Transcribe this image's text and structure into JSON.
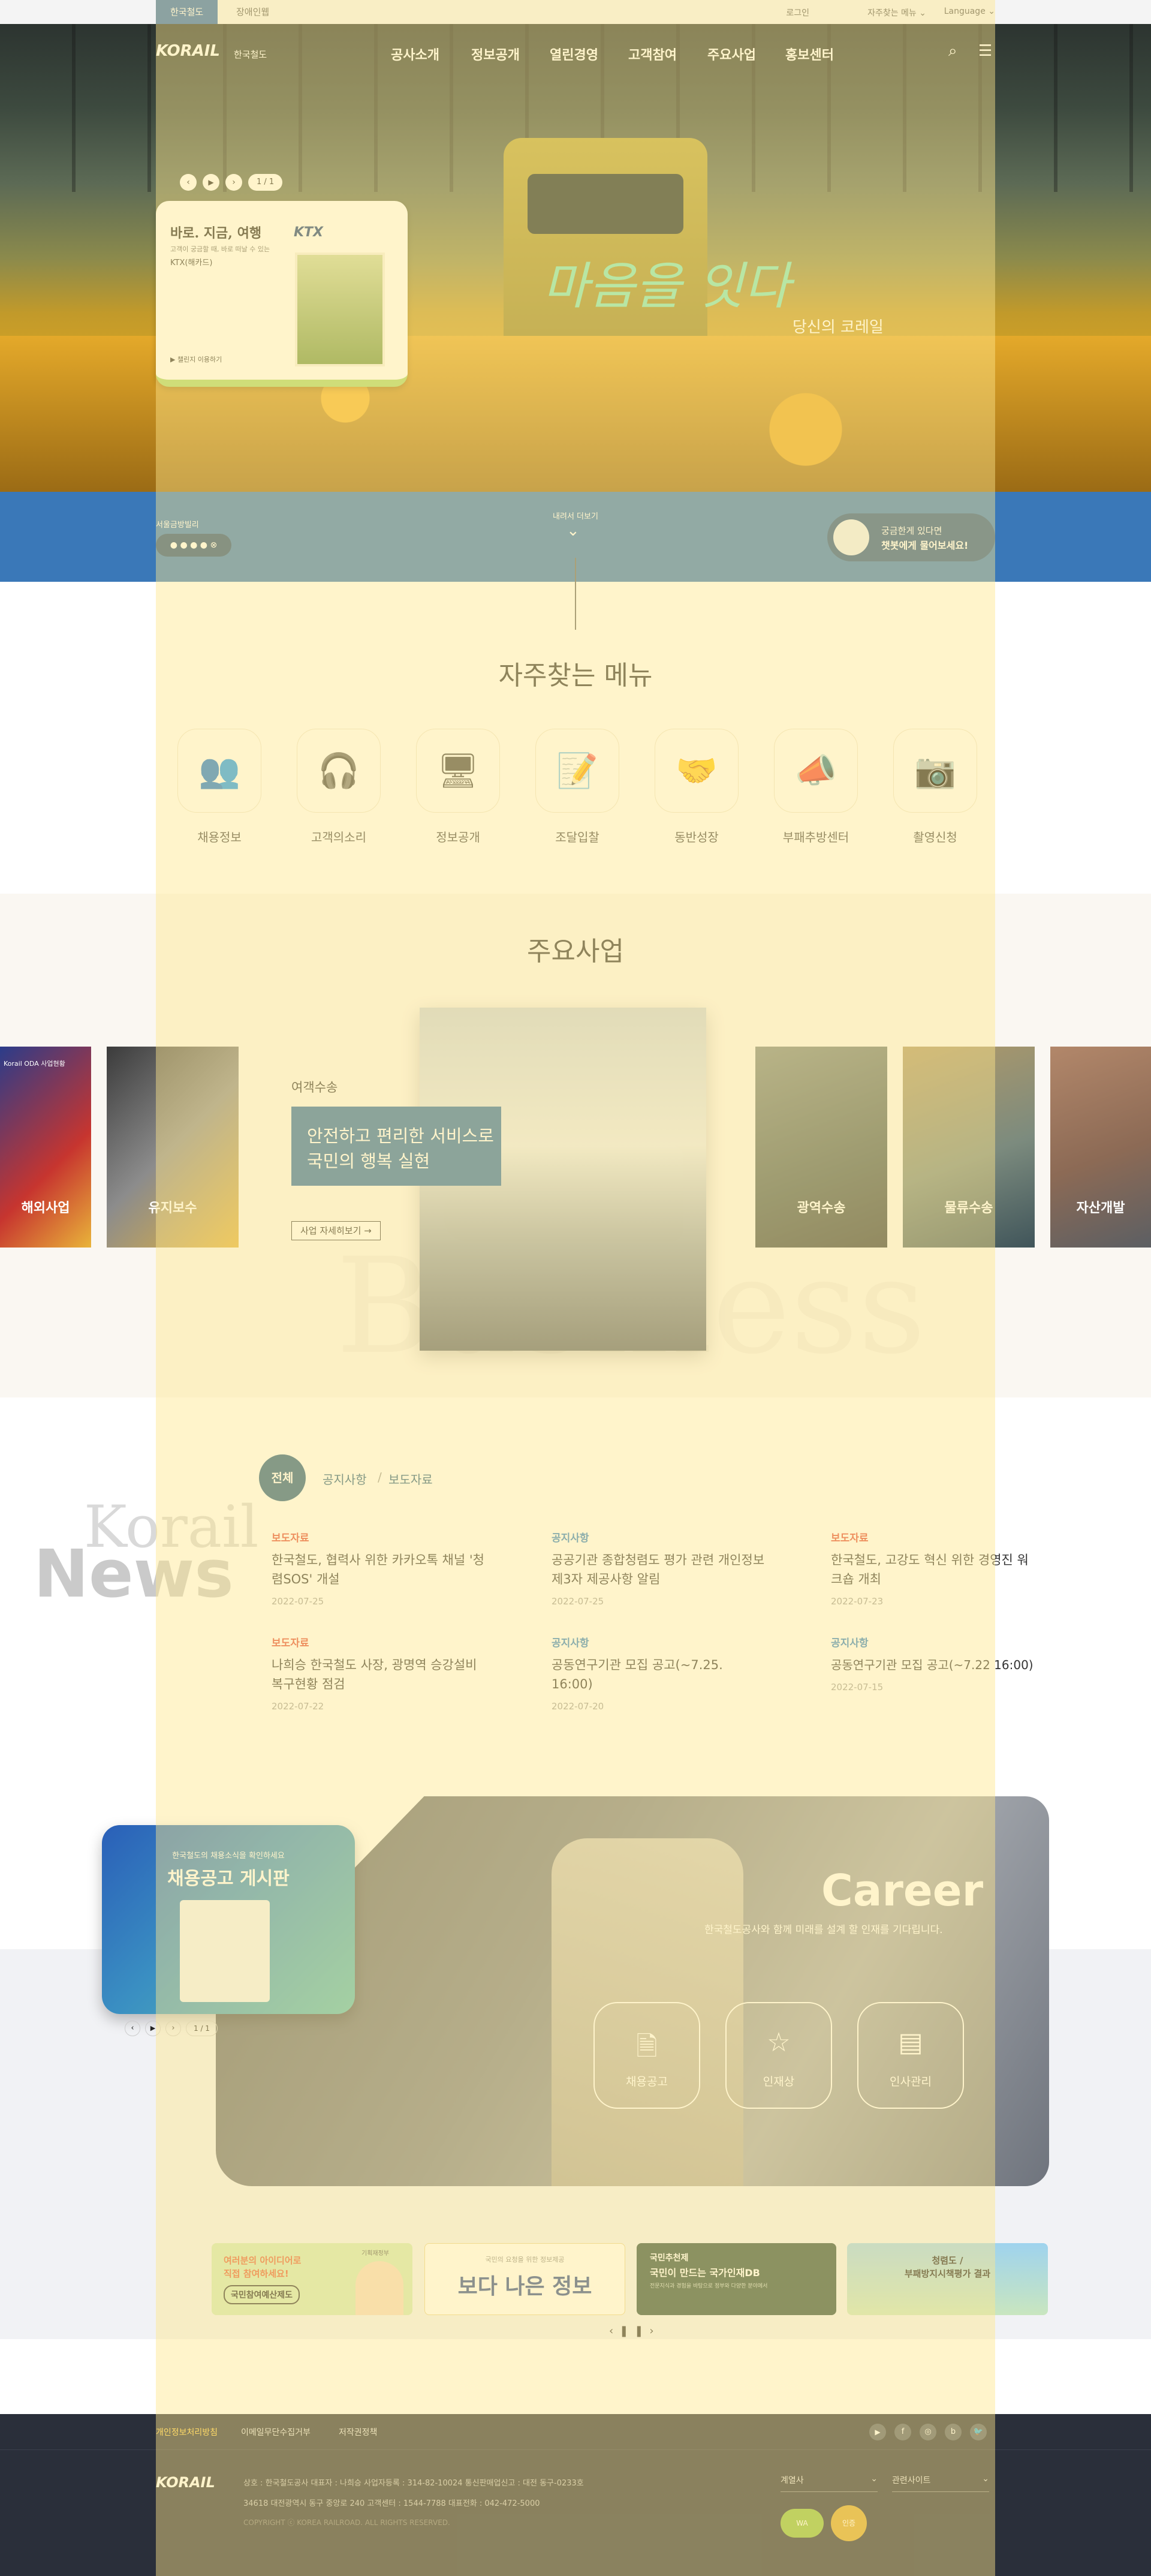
{
  "utility": {
    "tab_korail": "한국철도",
    "tab_disabled": "장애인웹",
    "login": "로그인",
    "frequent": "자주찾는 메뉴",
    "language": "Language"
  },
  "header": {
    "logo": "KORAIL",
    "logo_sub": "한국철도",
    "nav": [
      "공사소개",
      "정보공개",
      "열린경영",
      "고객참여",
      "주요사업",
      "홍보센터"
    ]
  },
  "hero": {
    "slide_counter": "1 / 1",
    "banner_title": "바로. 지금, 여행",
    "banner_desc": "고객이 궁금할 때, 바로 떠날 수 있는",
    "banner_sub": "KTX(해카드)",
    "banner_link": "▶ 챌린지 이용하기",
    "banner_brand": "KTX",
    "calligraphy": "마음을 잇다",
    "tagline": "당신의 코레일"
  },
  "band": {
    "left_label": "서울금방빌리",
    "center_label": "내려서 더보기",
    "chat_line1": "궁금한게 있다면",
    "chat_line2": "챗봇에게 물어보세요!"
  },
  "quickmenu": {
    "title": "자주찾는 메뉴",
    "items": [
      {
        "label": "채용정보",
        "icon": "people-icon"
      },
      {
        "label": "고객의소리",
        "icon": "headset-icon"
      },
      {
        "label": "정보공개",
        "icon": "monitor-icon"
      },
      {
        "label": "조달입찰",
        "icon": "document-pen-icon"
      },
      {
        "label": "동반성장",
        "icon": "handshake-icon"
      },
      {
        "label": "부패추방센터",
        "icon": "whistle-icon"
      },
      {
        "label": "촬영신청",
        "icon": "camera-doc-icon"
      }
    ]
  },
  "business": {
    "title": "주요사업",
    "category": "여객수송",
    "headline1": "안전하고 편리한 서비스로",
    "headline2": "국민의 행복 실현",
    "more": "사업 자세히보기 →",
    "watermark": "Business",
    "cards": [
      "해외사업",
      "유지보수",
      "광역수송",
      "물류수송",
      "자산개발"
    ],
    "overseas_banner": "Korail ODA 사업현황"
  },
  "news": {
    "watermark1": "Korail",
    "watermark2": "News",
    "tab_all": "전체",
    "tab_notice": "공지사항",
    "tab_press": "보도자료",
    "items": [
      {
        "cat": "보도자료",
        "title": "한국철도, 협력사 위한 카카오톡 채널 '청렴SOS' 개설",
        "date": "2022-07-25"
      },
      {
        "cat": "공지사항",
        "title": "공공기관 종합청렴도 평가 관련 개인정보 제3자 제공사항 알림",
        "date": "2022-07-25"
      },
      {
        "cat": "보도자료",
        "title": "한국철도, 고강도 혁신 위한 경영진 워크숍 개최",
        "date": "2022-07-23"
      },
      {
        "cat": "보도자료",
        "title": "나희승 한국철도 사장, 광명역 승강설비 복구현황 점검",
        "date": "2022-07-22"
      },
      {
        "cat": "공지사항",
        "title": "공동연구기관 모집 공고(~7.25. 16:00)",
        "date": "2022-07-20"
      },
      {
        "cat": "공지사항",
        "title": "공동연구기관 모집 공고(~7.22 16:00)",
        "date": "2022-07-15"
      }
    ]
  },
  "career": {
    "title": "Career",
    "subtitle": "한국철도공사와 함께 미래를 설계 할 인재를 기다립니다.",
    "board_small": "한국철도의 채용소식을 확인하세요",
    "board_title": "채용공고 게시판",
    "board_counter": "1 / 1",
    "buttons": [
      "채용공고",
      "인재상",
      "인사관리"
    ]
  },
  "banners": {
    "b1_l1": "여러분의 아이디어로",
    "b1_l2": "직접 참여하세요!",
    "b1_l3": "국민참여예산제도",
    "b1_badge": "기획재정부",
    "b2_small": "국민의 요청을 위한 정보제공",
    "b2_big": "보다 나은 정보",
    "b3_l1": "국민추천제",
    "b3_l2": "국민이 만드는 국가인재DB",
    "b3_l3": "전문지식과 경험을 바탕으로 정부와 다양한 분야에서",
    "b4_l1": "청렴도 /",
    "b4_l2": "부패방지시책평가 결과"
  },
  "footer": {
    "links": [
      "개인정보처리방침",
      "이메일무단수집거부",
      "저작권정책"
    ],
    "logo": "KORAIL",
    "address_line1": "상호 : 한국철도공사    대표자 : 나희승    사업자등록 : 314-82-10024    통신판매업신고 : 대전 동구-0233호",
    "address_line2": "34618 대전광역시 동구 중앙로 240    고객센터 : 1544-7788    대표전화 : 042-472-5000",
    "copyright": "COPYRIGHT ⓒ KOREA RAILROAD. ALL RIGHTS RESERVED.",
    "select1": "계열사",
    "select2": "관련사이트",
    "badge1": "WA",
    "badge2": "인증"
  }
}
